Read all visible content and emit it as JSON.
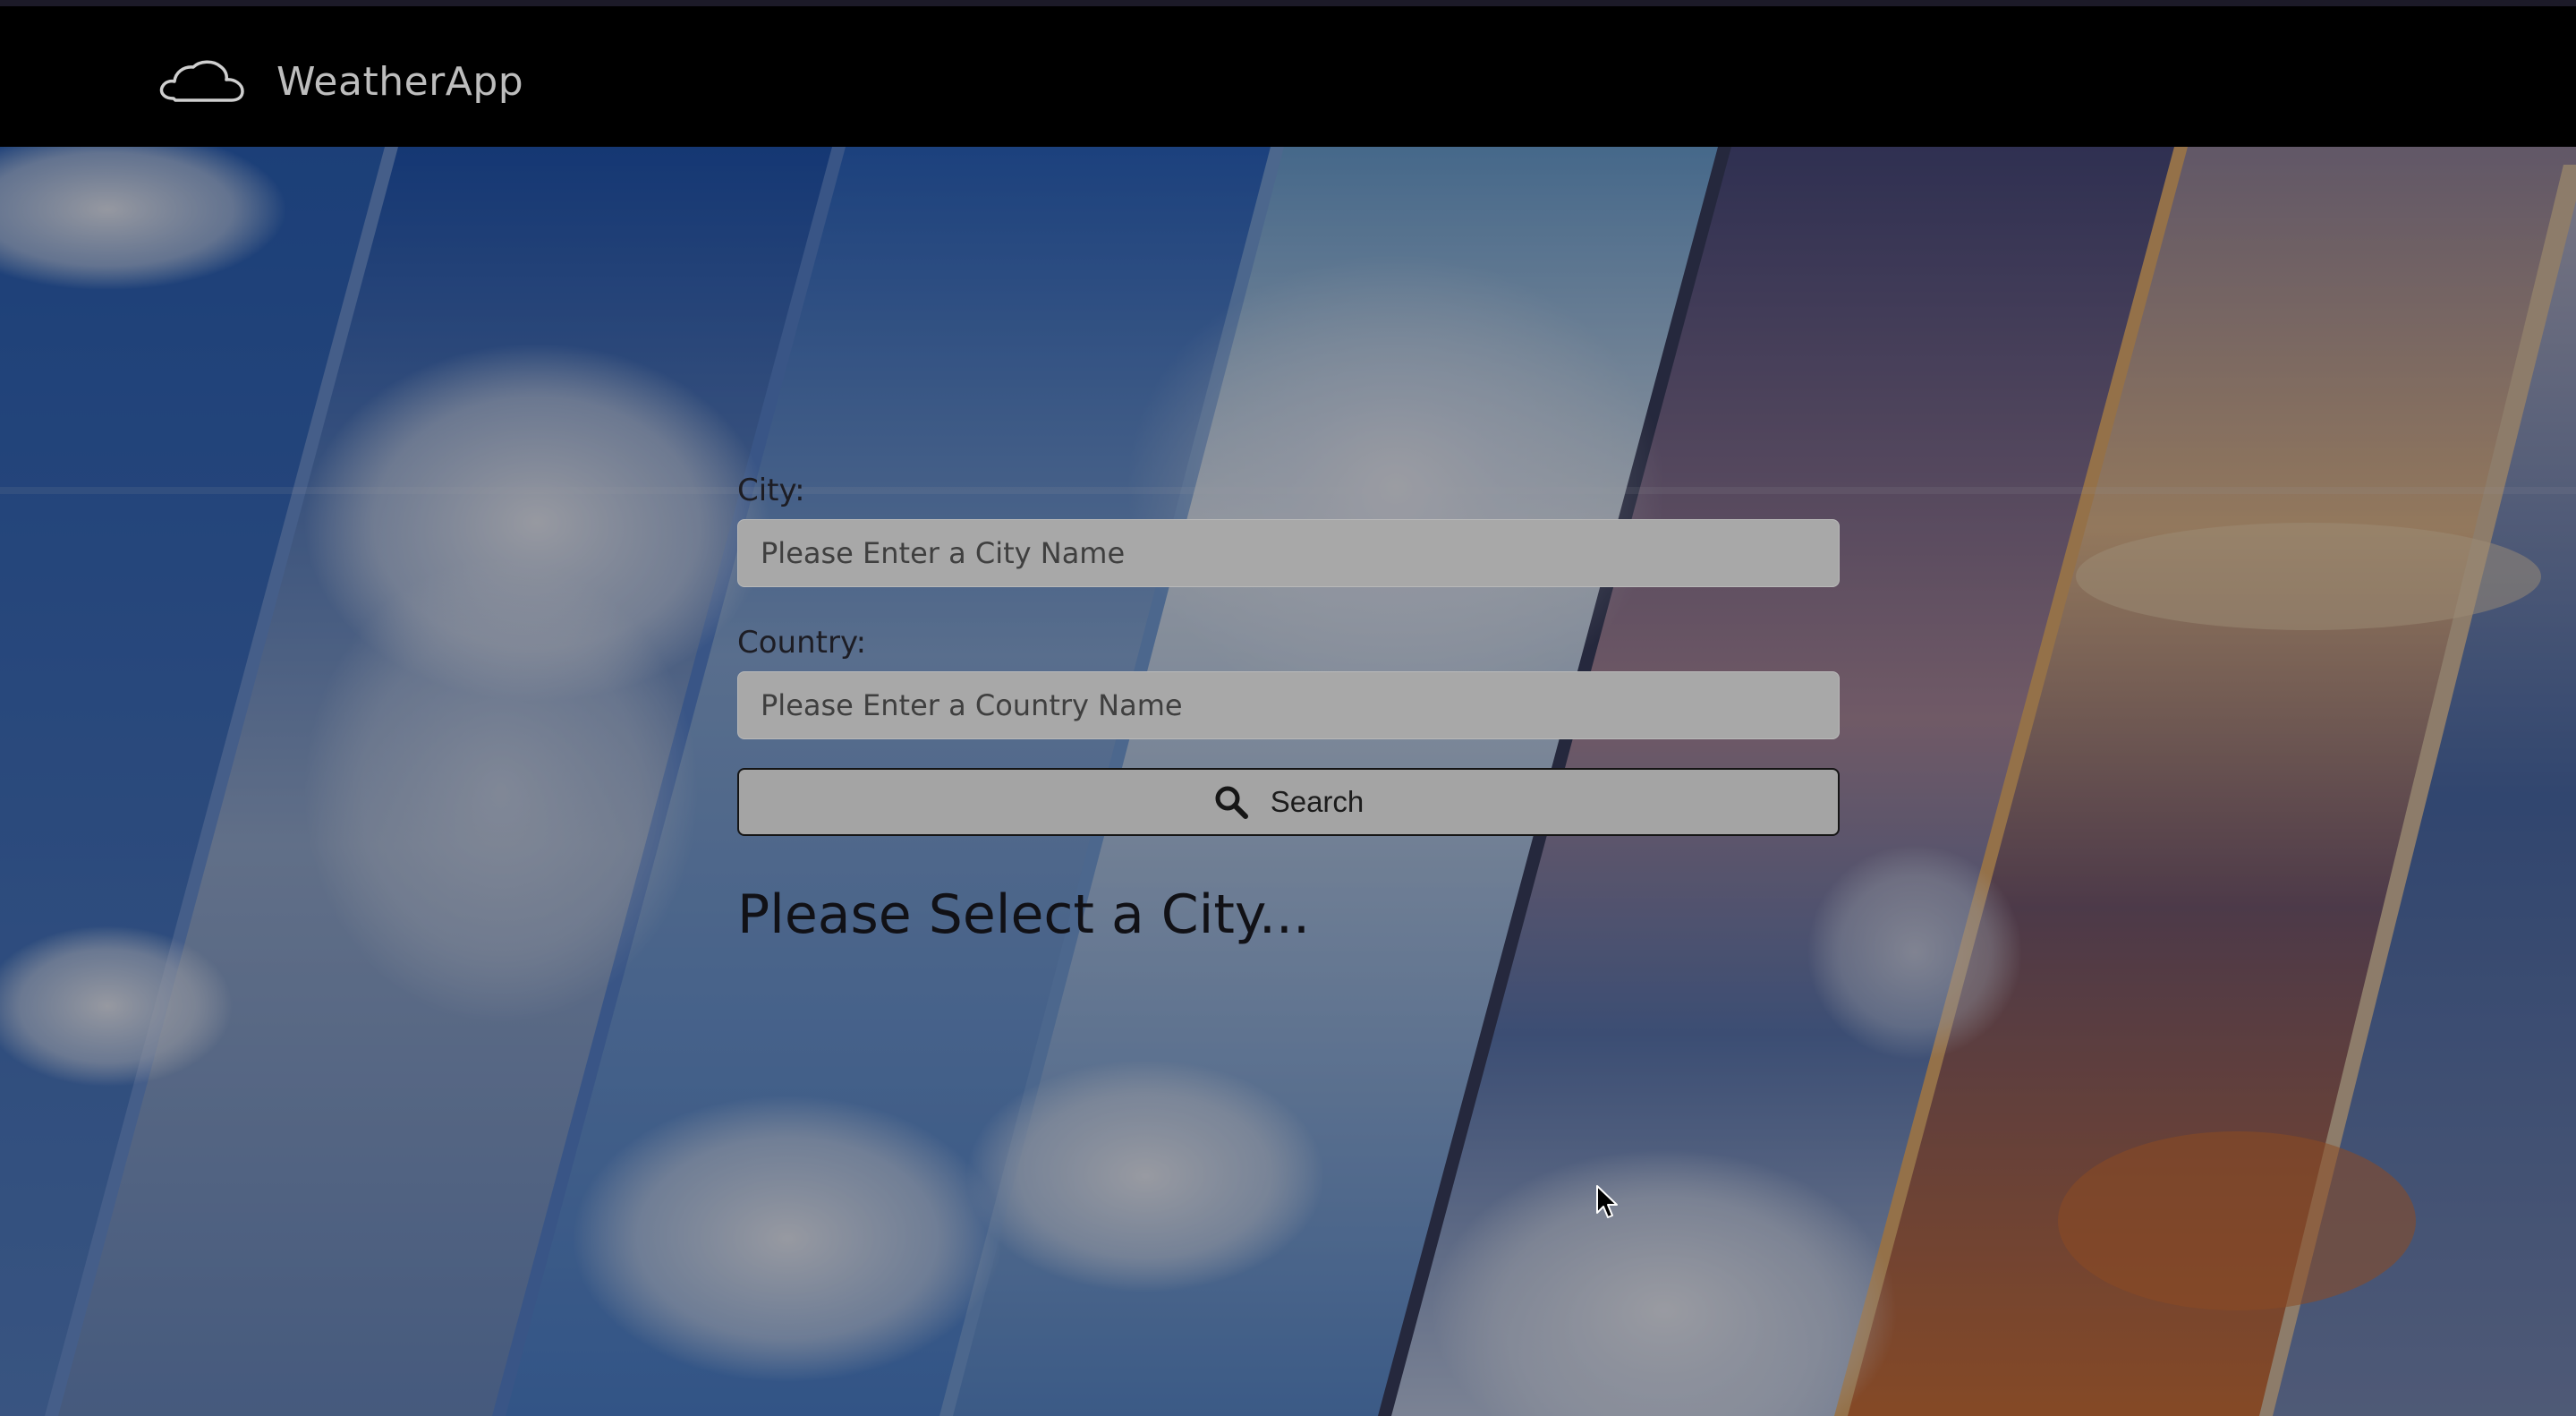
{
  "app": {
    "title": "WeatherApp",
    "logo_icon": "cloud-icon"
  },
  "form": {
    "city_label": "City:",
    "city_placeholder": "Please Enter a City Name",
    "city_value": "",
    "country_label": "Country:",
    "country_placeholder": "Please Enter a Country Name",
    "country_value": "",
    "search_label": "Search",
    "search_icon": "magnifier-icon"
  },
  "status": {
    "message": "Please Select a City..."
  },
  "colors": {
    "navbar": "#000000",
    "input_bg": "#a8a8a8",
    "button_bg": "#a4a4a4",
    "text_dark": "#111116",
    "brand_text": "#bdbdbd"
  }
}
